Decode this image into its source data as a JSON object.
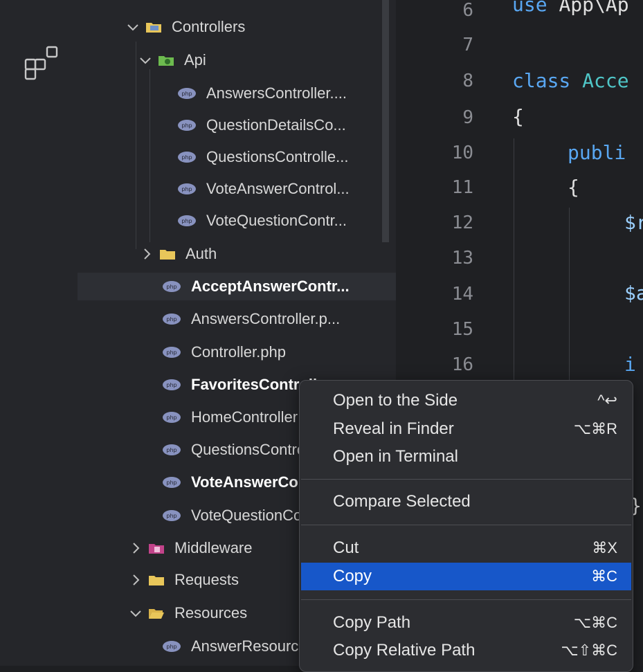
{
  "activity_bar": {
    "extensions_icon": "extensions-icon"
  },
  "explorer": {
    "items": [
      {
        "label": "Controllers",
        "icon": "folder-controllers-icon",
        "chevron": "expanded"
      },
      {
        "label": "Api",
        "icon": "folder-api-icon",
        "chevron": "expanded"
      },
      {
        "label": "AnswersController....",
        "icon": "php-file-icon"
      },
      {
        "label": "QuestionDetailsCo...",
        "icon": "php-file-icon"
      },
      {
        "label": "QuestionsControlle...",
        "icon": "php-file-icon"
      },
      {
        "label": "VoteAnswerControl...",
        "icon": "php-file-icon"
      },
      {
        "label": "VoteQuestionContr...",
        "icon": "php-file-icon"
      },
      {
        "label": "Auth",
        "icon": "folder-icon",
        "chevron": "collapsed"
      },
      {
        "label": "AcceptAnswerContr...",
        "icon": "php-file-icon",
        "selected": true
      },
      {
        "label": "AnswersController.p...",
        "icon": "php-file-icon"
      },
      {
        "label": "Controller.php",
        "icon": "php-file-icon"
      },
      {
        "label": "FavoritesController",
        "icon": "php-file-icon"
      },
      {
        "label": "HomeController",
        "icon": "php-file-icon"
      },
      {
        "label": "QuestionsController",
        "icon": "php-file-icon"
      },
      {
        "label": "VoteAnswerController",
        "icon": "php-file-icon"
      },
      {
        "label": "VoteQuestionController",
        "icon": "php-file-icon"
      },
      {
        "label": "Middleware",
        "icon": "folder-middleware-icon",
        "chevron": "collapsed"
      },
      {
        "label": "Requests",
        "icon": "folder-icon",
        "chevron": "collapsed"
      },
      {
        "label": "Resources",
        "icon": "folder-open-icon",
        "chevron": "expanded"
      },
      {
        "label": "AnswerResource",
        "icon": "php-file-icon"
      }
    ]
  },
  "editor": {
    "line_numbers": [
      "6",
      "7",
      "8",
      "9",
      "10",
      "11",
      "12",
      "13",
      "14",
      "15",
      "16"
    ],
    "code": {
      "line6_kw": "use",
      "line6_rest": "App\\Ap",
      "line8_kw": "class",
      "line8_cls": "Acce",
      "line9": "{",
      "line10_kw": "publi",
      "line11": "{",
      "line12_var": "$r",
      "line14_var": "$a",
      "line16_kw": "i",
      "line_close": "}"
    }
  },
  "context_menu": {
    "items": [
      {
        "label": "Open to the Side",
        "shortcut": "^↩"
      },
      {
        "label": "Reveal in Finder",
        "shortcut": "⌥⌘R"
      },
      {
        "label": "Open in Terminal",
        "shortcut": ""
      },
      {
        "label": "Compare Selected",
        "shortcut": ""
      },
      {
        "label": "Cut",
        "shortcut": "⌘X"
      },
      {
        "label": "Copy",
        "shortcut": "⌘C",
        "highlighted": true
      },
      {
        "label": "Copy Path",
        "shortcut": "⌥⌘C"
      },
      {
        "label": "Copy Relative Path",
        "shortcut": "⌥⇧⌘C"
      }
    ]
  },
  "colors": {
    "menu_highlight": "#1757c9",
    "php_icon": "#8892bf",
    "folder": "#e8c65a",
    "keyword": "#59a7f2",
    "class_name": "#4fc6c7"
  }
}
